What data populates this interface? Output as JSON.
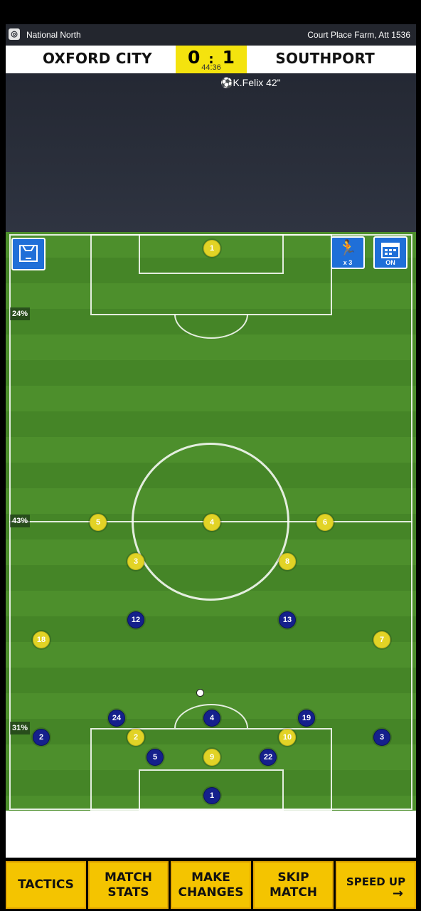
{
  "header": {
    "league": "National North",
    "venue": "Court Place Farm, Att 1536",
    "league_logo_icon": "league-logo-icon"
  },
  "score": {
    "home_team": "OXFORD CITY",
    "away_team": "SOUTHPORT",
    "home_goals": "0",
    "separator": ":",
    "away_goals": "1",
    "clock": "44:36"
  },
  "events": {
    "scorer": "K.Felix 42\""
  },
  "pitch": {
    "possession_top": "24%",
    "possession_middle": "43%",
    "possession_bottom": "31%",
    "speed_label": "x 3",
    "calendar_label": "ON"
  },
  "players_yellow": [
    "1",
    "5",
    "4",
    "6",
    "3",
    "8",
    "18",
    "7",
    "2",
    "10",
    "9"
  ],
  "players_blue": [
    "12",
    "13",
    "24",
    "4",
    "19",
    "2",
    "3",
    "5",
    "22",
    "1"
  ],
  "bottom_bar": {
    "tactics": "TACTICS",
    "match_stats": "MATCH STATS",
    "make_changes": "MAKE CHANGES",
    "skip_match": "SKIP MATCH",
    "speed_up": "SPEED UP"
  },
  "colors": {
    "accent": "#f4c400",
    "home_kit": "#e2d326",
    "away_kit": "#15208c",
    "pitch": "#4d8f2c"
  }
}
